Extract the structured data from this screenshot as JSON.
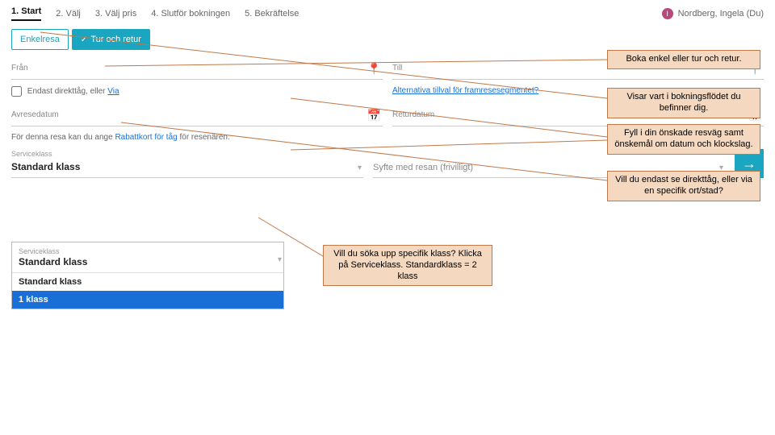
{
  "steps": {
    "s1": "1. Start",
    "s2": "2. Välj",
    "s3": "3. Välj pris",
    "s4": "4. Slutför bokningen",
    "s5": "5. Bekräftelse"
  },
  "user": {
    "initial": "I",
    "name": "Nordberg, Ingela (Du)"
  },
  "tabs": {
    "single": "Enkelresa",
    "round": "Tur och retur"
  },
  "fields": {
    "from": "Från",
    "to": "Till",
    "avresedatum": "Avresedatum",
    "returdatum": "Returdatum"
  },
  "hints": {
    "direct_prefix": "Endast direkttåg, eller",
    "via": "Via",
    "alt": "Alternativa tillval för framresesegmentet?"
  },
  "rabatt": {
    "prefix": "För denna resa kan du ange",
    "link": "Rabattkort för tåg",
    "suffix": "för resenären."
  },
  "selects": {
    "service_label": "Serviceklass",
    "service_value": "Standard klass",
    "syfte_label": "Syfte med resan",
    "syfte_hint": "(frivilligt)"
  },
  "dropdown": {
    "label": "Serviceklass",
    "current": "Standard klass",
    "opt1": "Standard klass",
    "opt2": "1 klass"
  },
  "callouts": {
    "c1": "Boka enkel eller tur och retur.",
    "c2": "Visar vart i bokningsflödet du befinner dig.",
    "c3": "Fyll i din önskade resväg samt önskemål om datum och klockslag.",
    "c4": "Vill du endast se direkttåg, eller via en specifik ort/stad?",
    "c5": "Vill du söka upp specifik klass? Klicka på Serviceklass. Standardklass = 2 klass"
  }
}
